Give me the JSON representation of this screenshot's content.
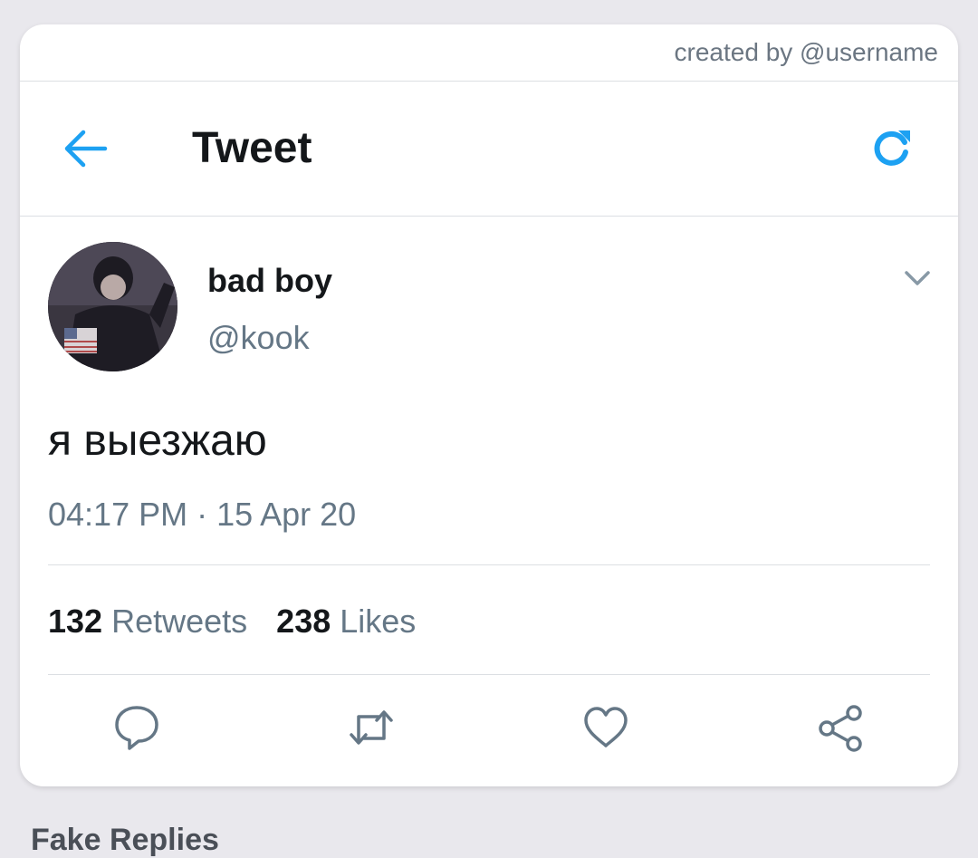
{
  "credit": "created by @username",
  "header": {
    "title": "Tweet"
  },
  "tweet": {
    "display_name": "bad boy",
    "handle": "@kook",
    "text": "я выезжаю",
    "timestamp": "04:17 PM · 15 Apr 20",
    "retweets_count": "132",
    "retweets_label": "Retweets",
    "likes_count": "238",
    "likes_label": "Likes"
  },
  "below_card": {
    "partial_text": "Fake Replies"
  },
  "icons": {
    "back": "arrow-left-icon",
    "refresh": "refresh-icon",
    "menu": "chevron-down-icon",
    "reply": "comment-icon",
    "retweet": "retweet-icon",
    "like": "heart-icon",
    "share": "share-icon"
  },
  "colors": {
    "accent": "#1da1f2",
    "text_primary": "#14171a",
    "text_secondary": "#657786",
    "background": "#e9e8ed",
    "card": "#ffffff"
  }
}
